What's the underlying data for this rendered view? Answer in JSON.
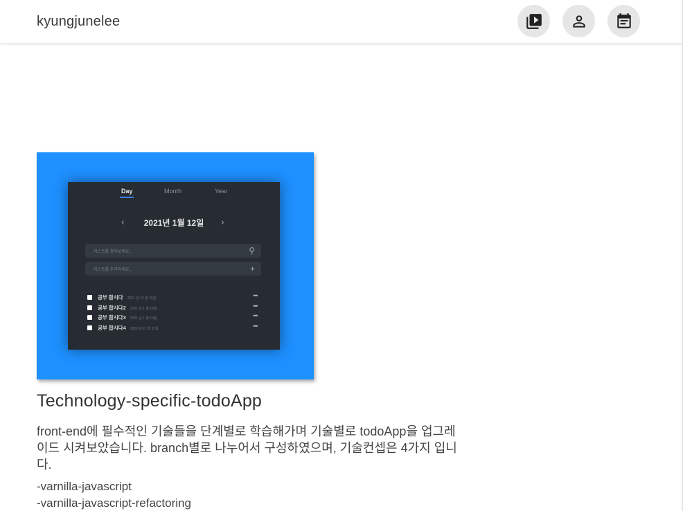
{
  "header": {
    "brand": "kyungjunelee",
    "buttons": [
      {
        "name": "portfolio",
        "icon": "video-library-icon"
      },
      {
        "name": "profile",
        "icon": "person-icon"
      },
      {
        "name": "calendar",
        "icon": "event-note-icon"
      }
    ]
  },
  "card": {
    "image": {
      "background": "#1e90ff",
      "panel_bg": "#272c33",
      "tabs": [
        "Day",
        "Month",
        "Year"
      ],
      "active_tab": "Day",
      "date": "2021년 1월 12일",
      "search_placeholder": "리스트를 찾아보세요...",
      "add_placeholder": "리스트를 추가하세요...",
      "todos": [
        {
          "text": "공부 합시다",
          "meta": "2021 년 12 월 15일"
        },
        {
          "text": "공부 합시다2",
          "meta": "2021 년 1 월 16일"
        },
        {
          "text": "공부 합시다3",
          "meta": "2021 년 1 월 14일"
        },
        {
          "text": "공부 합시다4",
          "meta": "2020 년 11 월 11일"
        }
      ]
    },
    "title": "Technology-specific-todoApp",
    "description": "front-end에 필수적인 기술들을 단계별로 학습해가며 기술별로 todoApp을 업그레이드 시켜보았습니다. branch별로 나누어서 구성하였으며, 기술컨셉은 4가지 입니다.",
    "branches": [
      "-varnilla-javascript",
      "-varnilla-javascript-refactoring"
    ]
  }
}
